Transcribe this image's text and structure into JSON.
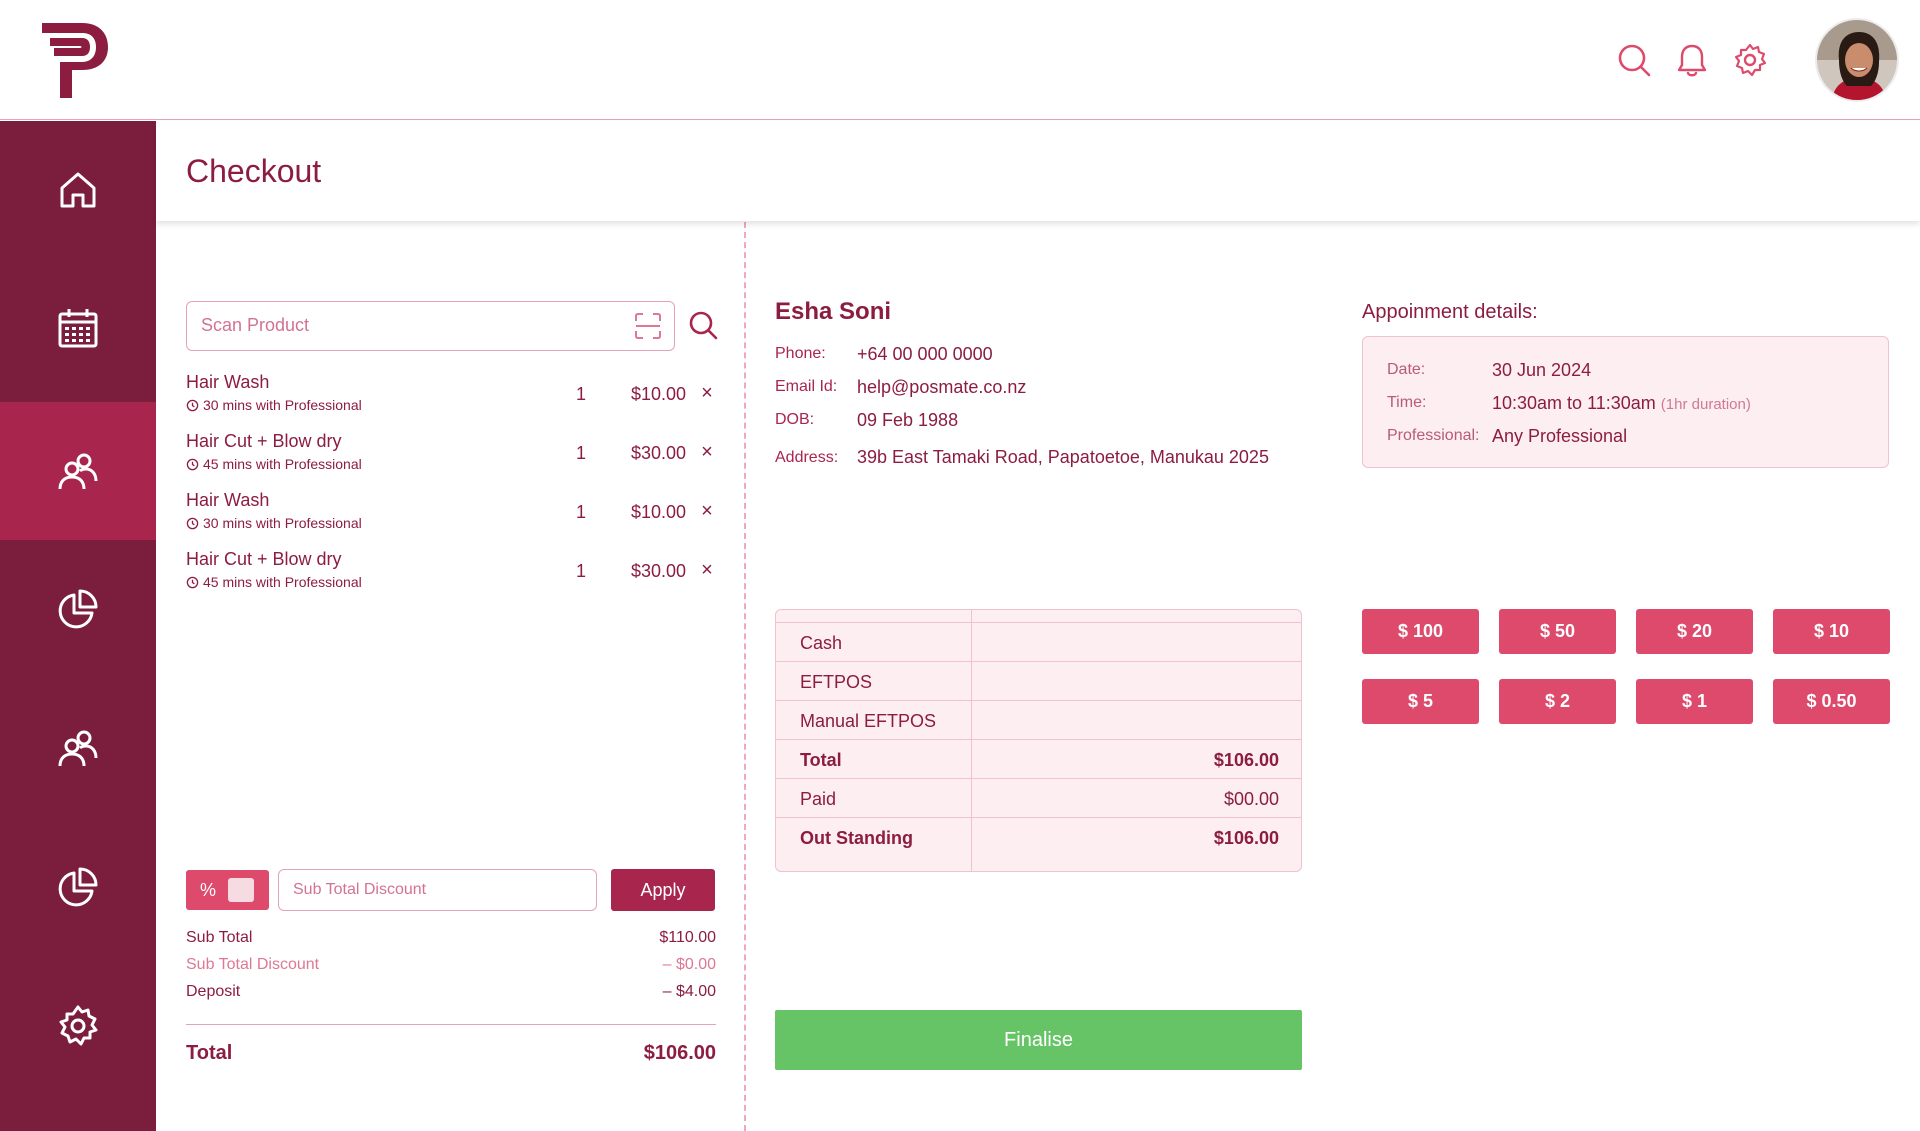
{
  "header": {
    "logo_icon": "posmate-logo-icon",
    "icons": [
      "search-icon",
      "bell-icon",
      "gear-icon"
    ],
    "avatar": "user-avatar"
  },
  "sidebar": {
    "items": [
      {
        "icon": "home-icon",
        "active": false
      },
      {
        "icon": "calendar-icon",
        "active": false
      },
      {
        "icon": "users-icon",
        "active": true
      },
      {
        "icon": "pie-chart-icon",
        "active": false
      },
      {
        "icon": "users-icon",
        "active": false
      },
      {
        "icon": "pie-chart-icon",
        "active": false
      },
      {
        "icon": "gear-icon",
        "active": false
      }
    ]
  },
  "page": {
    "title": "Checkout"
  },
  "scan": {
    "placeholder": "Scan Product"
  },
  "cart": [
    {
      "name": "Hair Wash",
      "sub": "30 mins with Professional",
      "qty": "1",
      "price": "$10.00"
    },
    {
      "name": "Hair Cut + Blow dry",
      "sub": "45 mins with Professional",
      "qty": "1",
      "price": "$30.00"
    },
    {
      "name": "Hair Wash",
      "sub": "30 mins with Professional",
      "qty": "1",
      "price": "$10.00"
    },
    {
      "name": "Hair Cut + Blow dry",
      "sub": "45 mins with Professional",
      "qty": "1",
      "price": "$30.00"
    }
  ],
  "discount": {
    "toggle_label": "%",
    "placeholder": "Sub Total Discount",
    "apply_label": "Apply"
  },
  "summary": {
    "subtotal_label": "Sub Total",
    "subtotal": "$110.00",
    "discount_label": "Sub Total Discount",
    "discount": "–  $0.00",
    "deposit_label": "Deposit",
    "deposit": "–  $4.00",
    "total_label": "Total",
    "total": "$106.00"
  },
  "customer": {
    "name": "Esha Soni",
    "phone_label": "Phone:",
    "phone": "+64 00 000 0000",
    "email_label": "Email Id:",
    "email": "help@posmate.co.nz",
    "dob_label": "DOB:",
    "dob": "09 Feb 1988",
    "address_label": "Address:",
    "address": "39b East Tamaki Road, Papatoetoe, Manukau 2025"
  },
  "appointment": {
    "title": "Appoinment details:",
    "date_label": "Date:",
    "date": "30 Jun 2024",
    "time_label": "Time:",
    "time": "10:30am to 11:30am",
    "duration": "(1hr duration)",
    "professional_label": "Professional:",
    "professional": "Any Professional"
  },
  "payments": [
    {
      "label": "Cash",
      "value": "",
      "bold": false
    },
    {
      "label": "EFTPOS",
      "value": "",
      "bold": false
    },
    {
      "label": "Manual EFTPOS",
      "value": "",
      "bold": false
    },
    {
      "label": "Total",
      "value": "$106.00",
      "bold": true
    },
    {
      "label": "Paid",
      "value": "$00.00",
      "bold": false
    },
    {
      "label": "Out Standing",
      "value": "$106.00",
      "bold": true
    }
  ],
  "cash_buttons": [
    "$ 100",
    "$ 50",
    "$ 20",
    "$ 10",
    "$ 5",
    "$ 2",
    "$ 1",
    "$ 0.50"
  ],
  "finalise_label": "Finalise",
  "colors": {
    "brand": "#7b1e3e",
    "accent": "#dd4a6c",
    "active_nav": "#a8254e",
    "success": "#66c466"
  }
}
